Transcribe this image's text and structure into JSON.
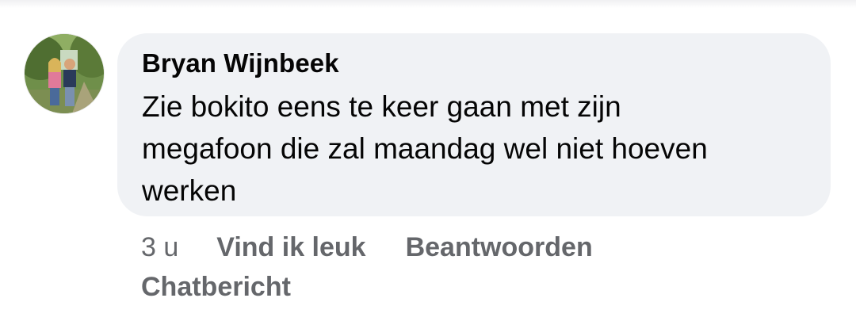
{
  "comment": {
    "author": "Bryan Wijnbeek",
    "text": "Zie bokito eens te keer gaan met zijn\nmegafoon die zal maandag wel niet hoeven\nwerken",
    "avatar_icon": "profile-photo"
  },
  "actions": {
    "time": "3 u",
    "like_label": "Vind ik leuk",
    "reply_label": "Beantwoorden",
    "chat_label": "Chatbericht"
  },
  "colors": {
    "bubble_bg": "#f0f2f5",
    "text": "#050505",
    "secondary_text": "#65676b"
  }
}
